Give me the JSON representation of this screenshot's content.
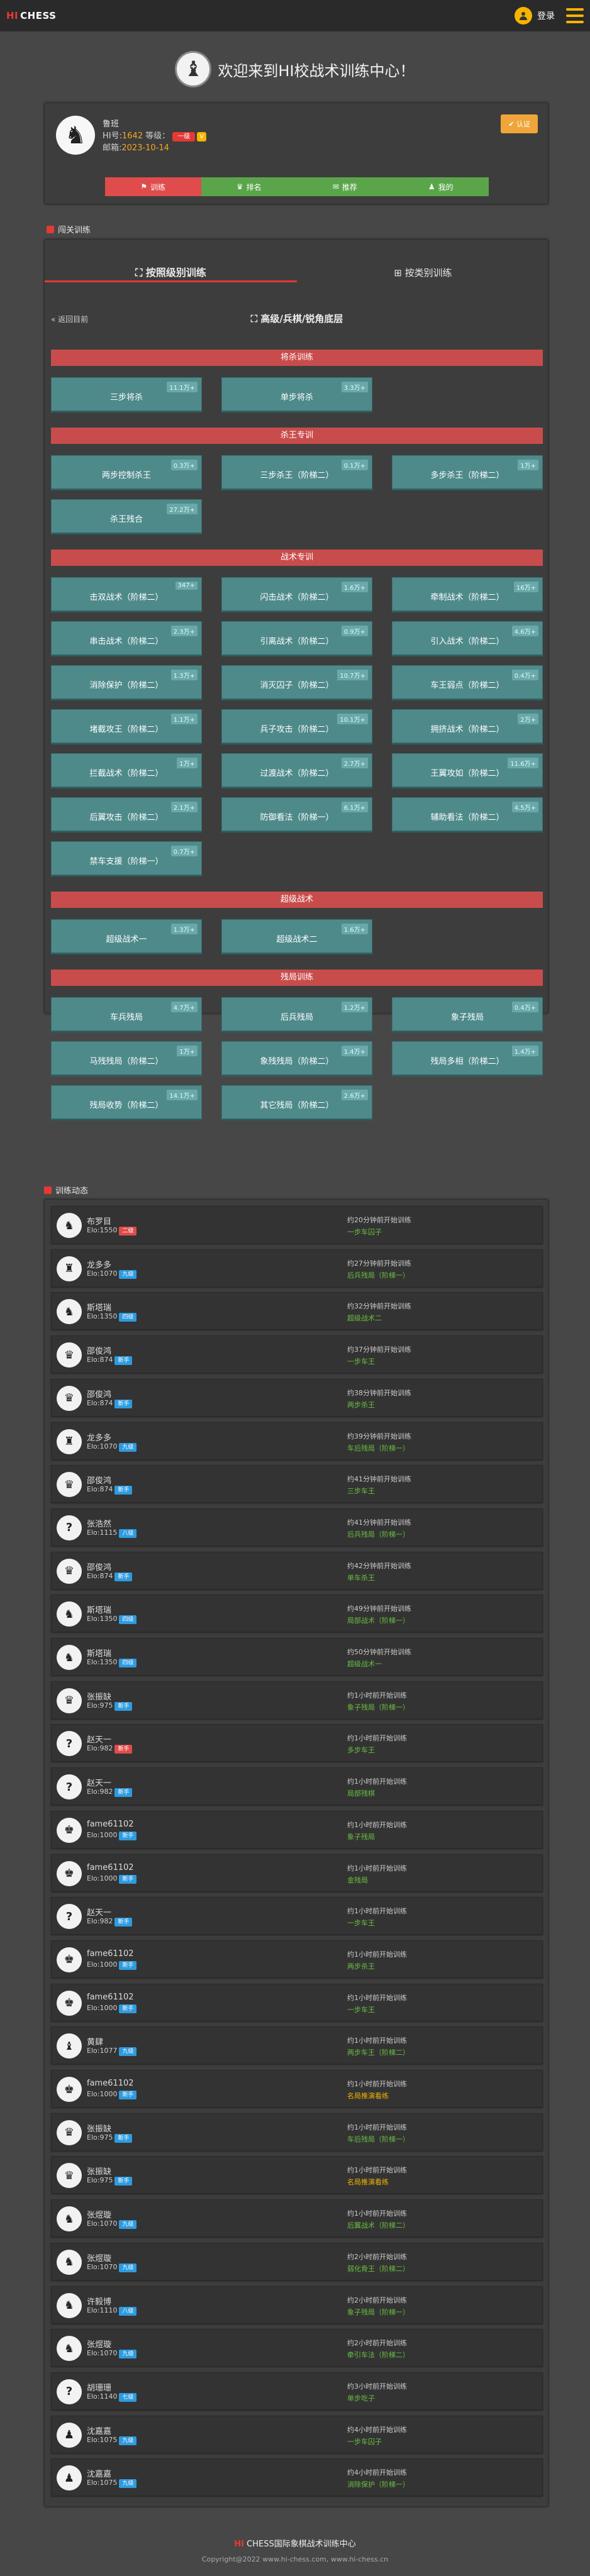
{
  "nav": {
    "logo_hi": "HI",
    "logo_rest": "CHESS",
    "login": "登录"
  },
  "welcome": {
    "title": "欢迎来到HI校战术训练中心！"
  },
  "profile": {
    "name": "鲁班",
    "id_label": "HI号:",
    "id": "1642",
    "level_label": "等级：",
    "level": "一级",
    "vip": "V",
    "email_label": "邮箱:",
    "email": "2023-10-14",
    "cert_button": "认证",
    "tabs": [
      {
        "label": "训练",
        "color": "#e04b4b"
      },
      {
        "label": "排名",
        "color": "#5aa54a"
      },
      {
        "label": "推荐",
        "color": "#5aa54a"
      },
      {
        "label": "我的",
        "color": "#5aa54a"
      }
    ]
  },
  "training": {
    "header": "闯关训练",
    "tab_active": "按照级别训练",
    "tab_inactive": "按类别训练",
    "back": "返回目前",
    "subtitle": "高级/兵棋/锐角底层",
    "sections": [
      {
        "title": "将杀训练",
        "items": [
          {
            "label": "三步将杀",
            "badge": "11.1万+"
          },
          {
            "label": "单步将杀",
            "badge": "3.3万+"
          }
        ]
      },
      {
        "title": "杀王专训",
        "items": [
          {
            "label": "两步控制杀王",
            "badge": "0.3万+"
          },
          {
            "label": "三步杀王（阶梯二）",
            "badge": "0.1万+"
          },
          {
            "label": "多步杀王（阶梯二）",
            "badge": "1万+"
          },
          {
            "label": "杀王残合",
            "badge": "27.2万+"
          }
        ]
      },
      {
        "title": "战术专训",
        "items": [
          {
            "label": "击双战术（阶梯二）",
            "badge": "347+"
          },
          {
            "label": "闪击战术（阶梯二）",
            "badge": "1.6万+"
          },
          {
            "label": "牵制战术（阶梯二）",
            "badge": "16万+"
          },
          {
            "label": "串击战术（阶梯二）",
            "badge": "2.3万+"
          },
          {
            "label": "引离战术（阶梯二）",
            "badge": "0.9万+"
          },
          {
            "label": "引入战术（阶梯二）",
            "badge": "4.6万+"
          },
          {
            "label": "消除保护（阶梯二）",
            "badge": "1.3万+"
          },
          {
            "label": "消灭囚子（阶梯二）",
            "badge": "10.7万+"
          },
          {
            "label": "车王弱点（阶梯二）",
            "badge": "0.4万+"
          },
          {
            "label": "堵截攻王（阶梯二）",
            "badge": "1.1万+"
          },
          {
            "label": "兵子攻击（阶梯二）",
            "badge": "10.1万+"
          },
          {
            "label": "拥挤战术（阶梯二）",
            "badge": "2万+"
          },
          {
            "label": "拦截战术（阶梯二）",
            "badge": "1万+"
          },
          {
            "label": "过渡战术（阶梯二）",
            "badge": "2.7万+"
          },
          {
            "label": "王翼攻如（阶梯二）",
            "badge": "11.6万+"
          },
          {
            "label": "后翼攻击（阶梯二）",
            "badge": "2.1万+"
          },
          {
            "label": "防御看法（阶梯一）",
            "badge": "6.1万+"
          },
          {
            "label": "辅助看法（阶梯二）",
            "badge": "4.5万+"
          },
          {
            "label": "禁车支援（阶梯一）",
            "badge": "0.7万+"
          }
        ]
      },
      {
        "title": "超级战术",
        "items": [
          {
            "label": "超级战术一",
            "badge": "1.3万+"
          },
          {
            "label": "超级战术二",
            "badge": "1.6万+"
          }
        ]
      },
      {
        "title": "残局训练",
        "items": [
          {
            "label": "车兵残局",
            "badge": "4.7万+"
          },
          {
            "label": "后兵残局",
            "badge": "1.2万+"
          },
          {
            "label": "象子残局",
            "badge": "0.4万+"
          },
          {
            "label": "马残残局（阶梯二）",
            "badge": "1万+"
          },
          {
            "label": "象残残局（阶梯二）",
            "badge": "1.4万+"
          },
          {
            "label": "残局多相（阶梯二）",
            "badge": "1.4万+"
          },
          {
            "label": "残局收势（阶梯二）",
            "badge": "14.1万+"
          },
          {
            "label": "其它残局（阶梯二）",
            "badge": "2.6万+"
          }
        ]
      }
    ]
  },
  "feed": {
    "header": "训练动态",
    "rows": [
      {
        "name": "布罗目",
        "elo": "Elo:1550",
        "rank": "二级",
        "rank_color": "#e04b4b",
        "avatar": "♞",
        "time": "约20分钟前开始训练",
        "puzzle": "一步车囚子",
        "puzzle_color": "#6abf40"
      },
      {
        "name": "龙多多",
        "elo": "Elo:1070",
        "rank": "九级",
        "rank_color": "#2e9be0",
        "avatar": "♜",
        "time": "约27分钟前开始训练",
        "puzzle": "后兵残局（阶梯一）",
        "puzzle_color": "#6abf40"
      },
      {
        "name": "斯塔瑞",
        "elo": "Elo:1350",
        "rank": "四级",
        "rank_color": "#2e9be0",
        "avatar": "♞",
        "time": "约32分钟前开始训练",
        "puzzle": "超级战术二",
        "puzzle_color": "#6abf40"
      },
      {
        "name": "邵俊鸿",
        "elo": "Elo:874",
        "rank": "新手",
        "rank_color": "#2e9be0",
        "avatar": "♛",
        "time": "约37分钟前开始训练",
        "puzzle": "一步车王",
        "puzzle_color": "#6abf40"
      },
      {
        "name": "邵俊鸿",
        "elo": "Elo:874",
        "rank": "新手",
        "rank_color": "#2e9be0",
        "avatar": "♛",
        "time": "约38分钟前开始训练",
        "puzzle": "两步杀王",
        "puzzle_color": "#6abf40"
      },
      {
        "name": "龙多多",
        "elo": "Elo:1070",
        "rank": "九级",
        "rank_color": "#2e9be0",
        "avatar": "♜",
        "time": "约39分钟前开始训练",
        "puzzle": "车后残局（阶梯一）",
        "puzzle_color": "#6abf40"
      },
      {
        "name": "邵俊鸿",
        "elo": "Elo:874",
        "rank": "新手",
        "rank_color": "#2e9be0",
        "avatar": "♛",
        "time": "约41分钟前开始训练",
        "puzzle": "三步车王",
        "puzzle_color": "#6abf40"
      },
      {
        "name": "张浩然",
        "elo": "Elo:1115",
        "rank": "八级",
        "rank_color": "#2e9be0",
        "avatar": "?",
        "time": "约41分钟前开始训练",
        "puzzle": "后兵残局（阶梯一）",
        "puzzle_color": "#6abf40"
      },
      {
        "name": "邵俊鸿",
        "elo": "Elo:874",
        "rank": "新手",
        "rank_color": "#2e9be0",
        "avatar": "♛",
        "time": "约42分钟前开始训练",
        "puzzle": "单车杀王",
        "puzzle_color": "#6abf40"
      },
      {
        "name": "斯塔瑞",
        "elo": "Elo:1350",
        "rank": "四级",
        "rank_color": "#2e9be0",
        "avatar": "♞",
        "time": "约49分钟前开始训练",
        "puzzle": "局部战术（阶梯一）",
        "puzzle_color": "#6abf40"
      },
      {
        "name": "斯塔瑞",
        "elo": "Elo:1350",
        "rank": "四级",
        "rank_color": "#2e9be0",
        "avatar": "♞",
        "time": "约50分钟前开始训练",
        "puzzle": "超级战术一",
        "puzzle_color": "#6abf40"
      },
      {
        "name": "张振缺",
        "elo": "Elo:975",
        "rank": "新手",
        "rank_color": "#2e9be0",
        "avatar": "♛",
        "time": "约1小时前开始训练",
        "puzzle": "象子残局（阶梯一）",
        "puzzle_color": "#6abf40"
      },
      {
        "name": "赵天一",
        "elo": "Elo:982",
        "rank": "新手",
        "rank_color": "#e04b4b",
        "avatar": "?",
        "time": "约1小时前开始训练",
        "puzzle": "多步车王",
        "puzzle_color": "#6abf40"
      },
      {
        "name": "赵天一",
        "elo": "Elo:982",
        "rank": "新手",
        "rank_color": "#2e9be0",
        "avatar": "?",
        "time": "约1小时前开始训练",
        "puzzle": "局部残棋",
        "puzzle_color": "#6abf40"
      },
      {
        "name": "fame61102",
        "elo": "Elo:1000",
        "rank": "新手",
        "rank_color": "#2e9be0",
        "avatar": "♚",
        "time": "约1小时前开始训练",
        "puzzle": "象子残局",
        "puzzle_color": "#6abf40"
      },
      {
        "name": "fame61102",
        "elo": "Elo:1000",
        "rank": "新手",
        "rank_color": "#2e9be0",
        "avatar": "♚",
        "time": "约1小时前开始训练",
        "puzzle": "金残局",
        "puzzle_color": "#6abf40"
      },
      {
        "name": "赵天一",
        "elo": "Elo:982",
        "rank": "新手",
        "rank_color": "#2e9be0",
        "avatar": "?",
        "time": "约1小时前开始训练",
        "puzzle": "一步车王",
        "puzzle_color": "#6abf40"
      },
      {
        "name": "fame61102",
        "elo": "Elo:1000",
        "rank": "新手",
        "rank_color": "#2e9be0",
        "avatar": "♚",
        "time": "约1小时前开始训练",
        "puzzle": "两步杀王",
        "puzzle_color": "#6abf40"
      },
      {
        "name": "fame61102",
        "elo": "Elo:1000",
        "rank": "新手",
        "rank_color": "#2e9be0",
        "avatar": "♚",
        "time": "约1小时前开始训练",
        "puzzle": "一步车王",
        "puzzle_color": "#6abf40"
      },
      {
        "name": "黄肆",
        "elo": "Elo:1077",
        "rank": "九级",
        "rank_color": "#2e9be0",
        "avatar": "♝",
        "time": "约1小时前开始训练",
        "puzzle": "两步车王（阶梯二）",
        "puzzle_color": "#6abf40"
      },
      {
        "name": "fame61102",
        "elo": "Elo:1000",
        "rank": "新手",
        "rank_color": "#2e9be0",
        "avatar": "♚",
        "time": "约1小时前开始训练",
        "puzzle": "名局推演看练",
        "puzzle_color": "#f5b400"
      },
      {
        "name": "张振缺",
        "elo": "Elo:975",
        "rank": "新手",
        "rank_color": "#2e9be0",
        "avatar": "♛",
        "time": "约1小时前开始训练",
        "puzzle": "车后残局（阶梯一）",
        "puzzle_color": "#6abf40"
      },
      {
        "name": "张振缺",
        "elo": "Elo:975",
        "rank": "新手",
        "rank_color": "#2e9be0",
        "avatar": "♛",
        "time": "约1小时前开始训练",
        "puzzle": "名局推演看练",
        "puzzle_color": "#f5b400"
      },
      {
        "name": "张煜璇",
        "elo": "Elo:1070",
        "rank": "九级",
        "rank_color": "#2e9be0",
        "avatar": "♞",
        "time": "约1小时前开始训练",
        "puzzle": "后翼战术（阶梯二）",
        "puzzle_color": "#6abf40"
      },
      {
        "name": "张煜璇",
        "elo": "Elo:1070",
        "rank": "九级",
        "rank_color": "#2e9be0",
        "avatar": "♞",
        "time": "约2小时前开始训练",
        "puzzle": "弱化骨王（阶梯二）",
        "puzzle_color": "#6abf40"
      },
      {
        "name": "许毅博",
        "elo": "Elo:1110",
        "rank": "八级",
        "rank_color": "#2e9be0",
        "avatar": "♞",
        "time": "约2小时前开始训练",
        "puzzle": "象子残局（阶梯一）",
        "puzzle_color": "#6abf40"
      },
      {
        "name": "张煜璇",
        "elo": "Elo:1070",
        "rank": "九级",
        "rank_color": "#2e9be0",
        "avatar": "♞",
        "time": "约2小时前开始训练",
        "puzzle": "牵引车法（阶梯二）",
        "puzzle_color": "#6abf40"
      },
      {
        "name": "胡珊珊",
        "elo": "Elo:1140",
        "rank": "七级",
        "rank_color": "#2e9be0",
        "avatar": "?",
        "time": "约3小时前开始训练",
        "puzzle": "单步吃子",
        "puzzle_color": "#6abf40"
      },
      {
        "name": "沈嘉嘉",
        "elo": "Elo:1075",
        "rank": "九级",
        "rank_color": "#2e9be0",
        "avatar": "♟",
        "time": "约4小时前开始训练",
        "puzzle": "一步车囚子",
        "puzzle_color": "#6abf40"
      },
      {
        "name": "沈嘉嘉",
        "elo": "Elo:1075",
        "rank": "九级",
        "rank_color": "#2e9be0",
        "avatar": "♟",
        "time": "约4小时前开始训练",
        "puzzle": "消除保护（阶梯一）",
        "puzzle_color": "#6abf40"
      }
    ]
  },
  "footer": {
    "brand_hi": "HI",
    "line1": "CHESS国际象棋战术训练中心",
    "line2": "Copyright@2022 www.hi-chess.com, www.hi-chess.cn"
  }
}
